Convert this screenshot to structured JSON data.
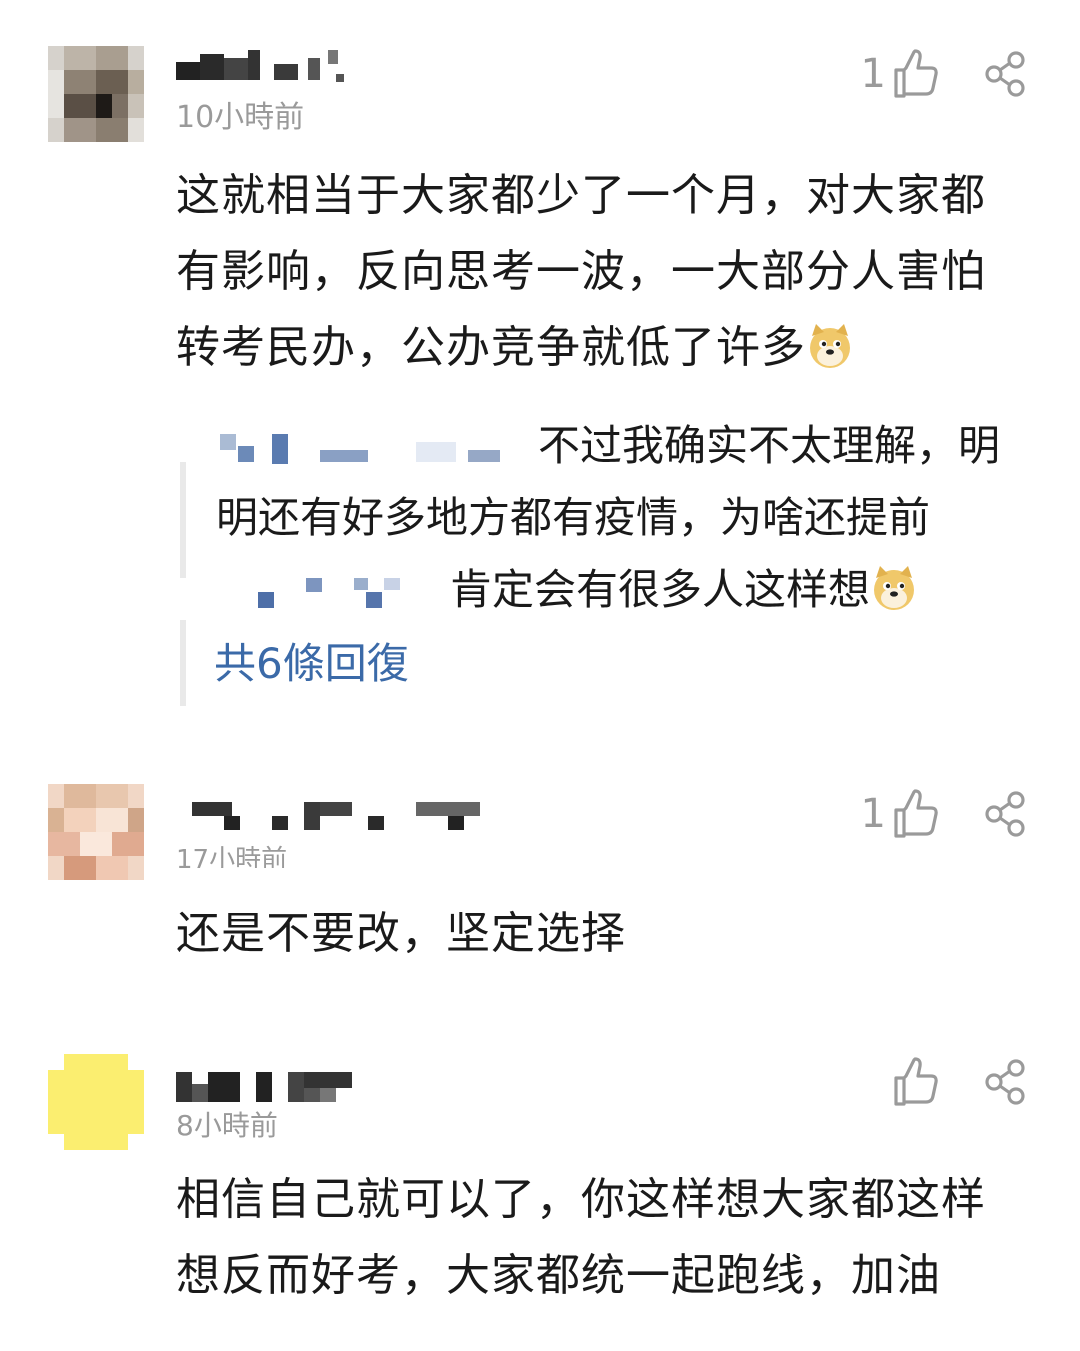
{
  "comments": [
    {
      "time": "10小時前",
      "likes": "1",
      "text_lines": [
        "这就相当于大家都少了一个月，对大家都",
        "有影响，反向思考一波，一大部分人害怕",
        "转考民办，公办竞争就低了许多"
      ],
      "replies": {
        "reply1_line1": "不过我确实不太理解，明",
        "reply1_line2": "明还有好多地方都有疫情，为啥还提前",
        "reply2_text": "肯定会有很多人这样想",
        "reply_count_label": "共6條回復"
      }
    },
    {
      "time": "17小時前",
      "likes": "1",
      "text_lines": [
        "还是不要改，坚定选择"
      ]
    },
    {
      "time": "8小時前",
      "likes": "",
      "text_lines": [
        "相信自己就可以了，你这样想大家都这样",
        "想反而好考，大家都统一起跑线，加油"
      ]
    }
  ],
  "icons": {
    "like": "thumbs-up-icon",
    "share": "share-icon",
    "emoji": "doge-emoji-icon"
  },
  "colors": {
    "link": "#3b6aa8",
    "muted": "#9a9a9a",
    "text": "#1a1a1a"
  }
}
